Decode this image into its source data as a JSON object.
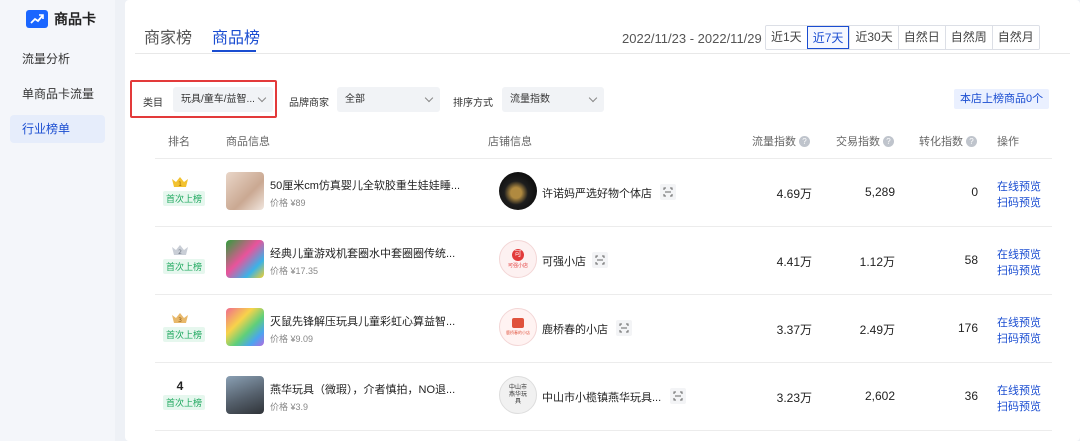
{
  "sidebar": {
    "brand_label": "商品卡",
    "brand_icon": "trend-chart-icon",
    "items": [
      {
        "label": "流量分析",
        "active": false
      },
      {
        "label": "单商品卡流量",
        "active": false
      },
      {
        "label": "行业榜单",
        "active": true
      }
    ]
  },
  "header": {
    "tabs": [
      {
        "label": "商家榜",
        "active": false
      },
      {
        "label": "商品榜",
        "active": true
      }
    ],
    "date_range": "2022/11/23 - 2022/11/29",
    "periods": [
      {
        "label": "近1天",
        "active": false
      },
      {
        "label": "近7天",
        "active": true
      },
      {
        "label": "近30天",
        "active": false
      },
      {
        "label": "自然日",
        "active": false
      },
      {
        "label": "自然周",
        "active": false
      },
      {
        "label": "自然月",
        "active": false
      }
    ]
  },
  "filters": {
    "category_label": "类目",
    "category_value": "玩具/童车/益智...",
    "brand_label": "品牌商家",
    "brand_value": "全部",
    "sort_label": "排序方式",
    "sort_value": "流量指数",
    "store_badge": "本店上榜商品0个"
  },
  "table": {
    "columns": {
      "rank": "排名",
      "product": "商品信息",
      "shop": "店铺信息",
      "traffic": "流量指数",
      "trade": "交易指数",
      "conversion": "转化指数",
      "action": "操作"
    },
    "rows": [
      {
        "rank": "1",
        "rank_badge": "gold-crown",
        "tag": "首次上榜",
        "title": "50厘米cm仿真婴儿全软胶重生娃娃睡...",
        "price": "价格 ¥89",
        "shop": "许诺妈严选好物个体店",
        "traffic": "4.69万",
        "trade": "5,289",
        "conversion": "0",
        "action1": "在线预览",
        "action2": "扫码预览"
      },
      {
        "rank": "2",
        "rank_badge": "silver-crown",
        "tag": "首次上榜",
        "title": "经典儿童游戏机套圈水中套圈圈传统...",
        "price": "价格 ¥17.35",
        "shop": "可强小店",
        "shop_logo_text": "可强小店",
        "traffic": "4.41万",
        "trade": "1.12万",
        "conversion": "58",
        "action1": "在线预览",
        "action2": "扫码预览"
      },
      {
        "rank": "3",
        "rank_badge": "bronze-crown",
        "tag": "首次上榜",
        "title": "灭鼠先锋解压玩具儿童彩虹心算益智...",
        "price": "价格 ¥9.09",
        "shop": "鹿桥春的小店",
        "shop_logo_text": "鹿桥春的小店",
        "traffic": "3.37万",
        "trade": "2.49万",
        "conversion": "176",
        "action1": "在线预览",
        "action2": "扫码预览"
      },
      {
        "rank": "4",
        "rank_badge": "",
        "tag": "首次上榜",
        "title": "燕华玩具（微瑕），介者慎拍，NO退...",
        "price": "价格 ¥3.9",
        "shop": "中山市小榄镇燕华玩具...",
        "shop_logo_text": "中山市燕华玩具",
        "traffic": "3.23万",
        "trade": "2,602",
        "conversion": "36",
        "action1": "在线预览",
        "action2": "扫码预览"
      }
    ]
  },
  "colors": {
    "accent": "#1a4dd1",
    "highlight_box": "#e33a3a",
    "tag_green": "#1fa85f"
  }
}
